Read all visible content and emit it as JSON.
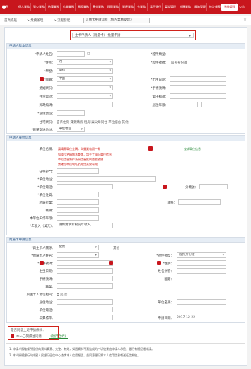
{
  "topnav": {
    "logo": "銀行",
    "items": [
      "個人業務",
      "對公業務",
      "結算業務",
      "信貸業務",
      "國際業務",
      "基金業務",
      "理財業務",
      "資產業務",
      "卡業務",
      "電子銀行",
      "渠道管理",
      "外匯業務",
      "風險管理",
      "統計報表",
      "系統管理",
      "公告"
    ]
  },
  "crumbbar": {
    "home": "首頁導航",
    "sep1": "> 業務辦理",
    "sep2": "> 流程發起",
    "tab_title": "信用卡申請流程（個人業務受理）",
    "close": "×"
  },
  "mode_select": {
    "value": "主卡申請人（附屬卡） 批量申請"
  },
  "section1": {
    "title": "申請人基本信息",
    "fields": {
      "name_label": "*申請人姓名：",
      "name_value": "",
      "card_type_label": "*證件類型：",
      "card_type_value": "居民身份證",
      "card_no_label": "*證件號碼：",
      "card_no_value": "",
      "gender_label": "*性別：",
      "gender_value": "男",
      "birth_label": "*出生日期：",
      "birth_value": "",
      "nation_label": "*國籍：",
      "nation_value": "中國",
      "edu_label": "*學歷：",
      "edu_value": "本科",
      "marriage_label": "婚姻狀況：",
      "marriage_value": "",
      "phone_label": "*手機號碼：",
      "phone_value": "",
      "home_label": "住宅電話：",
      "home_value": "",
      "address_label": "*居住地址：",
      "address_value": "",
      "zip_label": "郵政編碼：",
      "zip_value": "",
      "years_label": "居住年限：",
      "years_value": "",
      "email_label": "電子郵箱：",
      "email_value": "",
      "house_label": "住宅狀況：",
      "house_options": "自有住房  貸款購房  租房  與父母同住  單位宿舍  其他",
      "bill_label": "*賬單寄送地址：",
      "bill_value": "單位地址"
    }
  },
  "section2": {
    "title": "申請人單位信息",
    "hint1_label": "單位名稱：",
    "hint1": "請填寫單位全稱，與營業執照一致",
    "hint_link": "查詢單位信息",
    "notes": [
      "如單位名稱無法查詢，請手工錄入單位信息",
      "單位信息將作為授信審批的重要依據",
      "請確認單位地址及電話真實有效"
    ],
    "dept_label": "任職部門：",
    "addr_label": "*單位地址：",
    "phone_label": "*單位電話：",
    "phone2_label": "分機號：",
    "nature_label": "*單位性質：",
    "industry_label": "所屬行業：",
    "position_label": "職務：",
    "title_label": "職稱：",
    "work_years_label": "本單位工作年限：",
    "income_label": "*年收入（萬元）：",
    "income_hint": "請如實填寫稅前年收入"
  },
  "section3": {
    "title": "附屬卡申請信息",
    "relation_label": "*與主卡人關係：",
    "relation_value": "配偶",
    "relation_note": "其他",
    "name_label": "*附屬卡人姓名：",
    "name_value": "",
    "card_type_label": "*證件類型：",
    "card_type_value": "居民身份證",
    "card_no_label": "*證件號碼：",
    "gender_label": "*性別：",
    "birth_label": "出生日期：",
    "pinyin_label": "姓名拼音：",
    "phone_label": "手機號碼：",
    "nation_label": "國籍：",
    "occupation_label": "職業：",
    "same_addr_label": "與主卡人地址相同：",
    "same_addr_opts": "是  否",
    "addr_label": "居住地址：",
    "company_label": "單位名稱：",
    "company_phone_label": "單位電話：",
    "fee_label": "年費標準：",
    "date_label": "申請日期：",
    "date_value": "2017-12-22"
  },
  "confirm": {
    "label": "是否同意上述申請條款：",
    "checkbox_label": "本人已閱讀並同意",
    "agree_link": "《領用合約》"
  },
  "footnotes": [
    "1. 申請人應確保所提供的資料真實、完整、有效，如因資料不實造成的一切後果由申請人承擔，銀行有權拒絕申請。",
    "2. 本人授權銀行向中國人民銀行征信中心查詢本人信用報告，並同意銀行將本人信用信息報送征信系統。"
  ]
}
